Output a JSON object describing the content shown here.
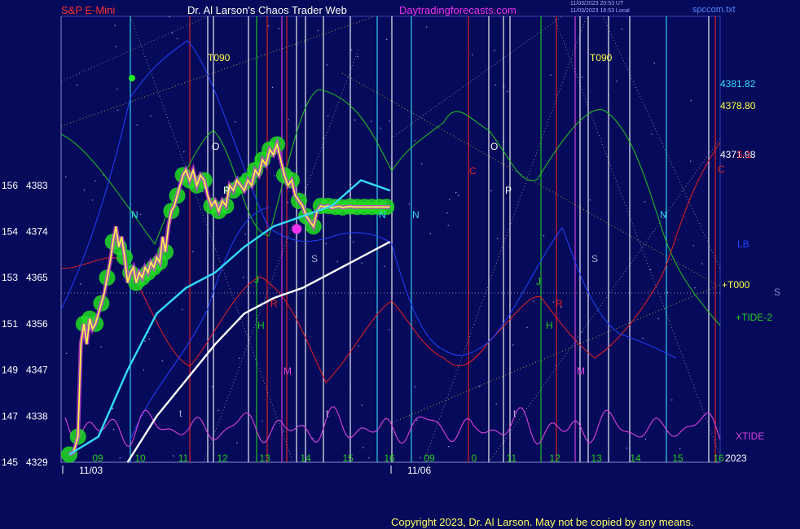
{
  "header": {
    "instrument": "S&P E-Mini",
    "title": "Dr. Al Larson's Chaos Trader Web",
    "site": "Daytradingforecasts.com",
    "timestamp_utc": "11/03/2023 20:53 UT",
    "timestamp_local": "11/03/2023 16:53 Local",
    "file": "spccom.txt"
  },
  "colors": {
    "background": "#050a5a",
    "price": "#ffff44",
    "green_band": "#22dd22",
    "cyan_ma": "#33ddff",
    "white_ma": "#ffffff",
    "green_wave": "#22cc22",
    "red_wave": "#ee2222",
    "blue_wave": "#2244ff",
    "xtide": "#dd44dd"
  },
  "copyright": "Copyright 2023, Dr. Al Larson. May not be copied by any means.",
  "chart_data": {
    "type": "line",
    "yaxis": {
      "labels": [
        {
          "value": 4329,
          "alt": "145",
          "text": "4329"
        },
        {
          "value": 4338,
          "alt": "147",
          "text": "4338"
        },
        {
          "value": 4347,
          "alt": "149",
          "text": "4347"
        },
        {
          "value": 4356,
          "alt": "151",
          "text": "4356"
        },
        {
          "value": 4365,
          "alt": "153",
          "text": "4365"
        },
        {
          "value": 4374,
          "alt": "154",
          "text": "4374"
        },
        {
          "value": 4383,
          "alt": "156",
          "text": "4383"
        }
      ],
      "ylim": [
        4329,
        4392
      ]
    },
    "xaxis": {
      "hours": [
        "09",
        "10",
        "11",
        "12",
        "13",
        "14",
        "15",
        "16",
        "09",
        "0",
        "11",
        "12",
        "13",
        "14",
        "15",
        "16"
      ],
      "dates": [
        "11/03",
        "11/06"
      ],
      "year": "2023"
    },
    "right_labels": [
      {
        "text": "4381.82",
        "value": 4381.82,
        "color": "#33ddff"
      },
      {
        "text": "4378.80",
        "value": 4378.8,
        "color": "#ffff44"
      },
      {
        "text": "4371.98",
        "value": 4371.98,
        "color": "#ffffff"
      },
      {
        "text": "LB",
        "color": "#2244ff"
      },
      {
        "text": "+T000",
        "color": "#ffff44"
      },
      {
        "text": "+TIDE-2",
        "color": "#22cc22"
      },
      {
        "text": "XTIDE",
        "color": "#dd44dd"
      },
      {
        "text": "S",
        "color": "#8888cc"
      },
      {
        "text": "5-1",
        "color": "#ee2222"
      }
    ],
    "series": [
      {
        "name": "S&P E-Mini",
        "color": "#ffff44",
        "x": [
          0,
          0.3,
          0.6,
          0.8,
          1,
          1.2,
          1.4,
          1.6,
          1.8,
          2,
          2.2,
          2.4,
          2.6,
          2.8,
          3,
          3.2,
          3.4,
          3.6,
          3.8,
          4,
          4.2,
          4.4,
          4.6,
          4.8,
          5,
          5.2,
          5.4,
          5.6,
          5.8,
          6,
          6.2,
          6.4,
          6.6,
          6.8,
          7,
          7.2,
          7.4,
          7.6,
          7.8,
          8.0,
          8.25,
          8.5,
          8.75,
          9.0,
          9.25,
          9.5,
          9.75,
          10.0,
          10.25,
          10.5,
          10.75,
          11.0,
          11.25,
          11.5,
          11.75,
          12.0,
          12.25,
          12.5,
          12.75,
          13.0,
          13.25,
          13.5,
          13.75,
          14.0,
          14.25,
          14.5,
          14.75,
          15.0,
          15.25,
          15.5,
          15.75,
          16.0,
          16.25,
          16.5,
          16.75,
          17.0,
          17.25,
          17.5,
          17.75,
          18.0,
          18.25,
          18.5,
          18.75,
          19.0,
          19.25,
          19.5,
          19.75,
          20.0,
          20.25,
          20.5,
          20.75,
          21.0,
          21.25,
          21.5,
          21.75,
          22.0
        ],
        "y": [
          4330.5,
          4331,
          4334,
          4352,
          4356,
          4352,
          4357,
          4355,
          4356,
          4358,
          4360,
          4362,
          4365,
          4368,
          4372,
          4375,
          4371,
          4373,
          4369,
          4364,
          4366,
          4367,
          4364,
          4366,
          4365,
          4367,
          4366,
          4368,
          4367,
          4369,
          4368,
          4373,
          4370,
          4375,
          4378,
          4379,
          4381,
          4383,
          4385,
          4386,
          4384,
          4386,
          4383,
          4385,
          4384,
          4381,
          4379,
          4380,
          4378,
          4380,
          4379,
          4383,
          4382,
          4384,
          4383,
          4382,
          4384,
          4383,
          4386,
          4385,
          4388,
          4387,
          4390,
          4389,
          4391,
          4388,
          4385,
          4383,
          4384,
          4381,
          4380,
          4379,
          4377,
          4376,
          4375,
          4378,
          4379,
          4378.8,
          4379,
          4378.6,
          4378.8,
          4378.9,
          4378.7,
          4378.8,
          4378.9,
          4378.8,
          4378.8,
          4378.8,
          4378.8,
          4378.8,
          4378.8,
          4378.8,
          4378.8,
          4378.8,
          4378.8,
          4378.8
        ]
      },
      {
        "name": "",
        "color": "#33ddff",
        "x": [
          0,
          2,
          4,
          6,
          8,
          10,
          12,
          14,
          16,
          18,
          20,
          22
        ],
        "y": [
          4330.5,
          4334,
          4347,
          4358,
          4363,
          4366,
          4371,
          4375,
          4377,
          4379,
          4384,
          4382
        ]
      },
      {
        "name": "",
        "color": "#ffffff",
        "x": [
          4,
          6,
          8,
          10,
          12,
          14,
          16,
          18,
          20,
          22
        ],
        "y": [
          4329,
          4338,
          4345,
          4352,
          4358,
          4361,
          4363,
          4366,
          4369,
          4372
        ]
      }
    ],
    "vline_labels": [
      {
        "text": "T090",
        "color": "#ffff44"
      },
      {
        "text": "T090",
        "color": "#ffff44"
      },
      {
        "text": "O",
        "color": "#ffffff"
      },
      {
        "text": "O",
        "color": "#ffffff"
      },
      {
        "text": "P",
        "color": "#ffffff"
      },
      {
        "text": "P",
        "color": "#ffffff"
      },
      {
        "text": "N",
        "color": "#33ddff"
      },
      {
        "text": "N",
        "color": "#33ddff"
      },
      {
        "text": "N",
        "color": "#33ddff"
      },
      {
        "text": "N",
        "color": "#33ddff"
      },
      {
        "text": "S",
        "color": "#aaaacc"
      },
      {
        "text": "S",
        "color": "#aaaacc"
      },
      {
        "text": "C",
        "color": "#ee2222"
      },
      {
        "text": "C",
        "color": "#ee2222"
      },
      {
        "text": "J",
        "color": "#22cc22"
      },
      {
        "text": "J",
        "color": "#22cc22"
      },
      {
        "text": "H",
        "color": "#22cc22"
      },
      {
        "text": "H",
        "color": "#22cc22"
      },
      {
        "text": "R",
        "color": "#ee2222"
      },
      {
        "text": "R",
        "color": "#ee2222"
      },
      {
        "text": "M",
        "color": "#dd44dd"
      },
      {
        "text": "M",
        "color": "#dd44dd"
      },
      {
        "text": "t",
        "color": "#aaaacc"
      },
      {
        "text": "t",
        "color": "#aaaacc"
      },
      {
        "text": "t",
        "color": "#aaaacc"
      }
    ]
  }
}
